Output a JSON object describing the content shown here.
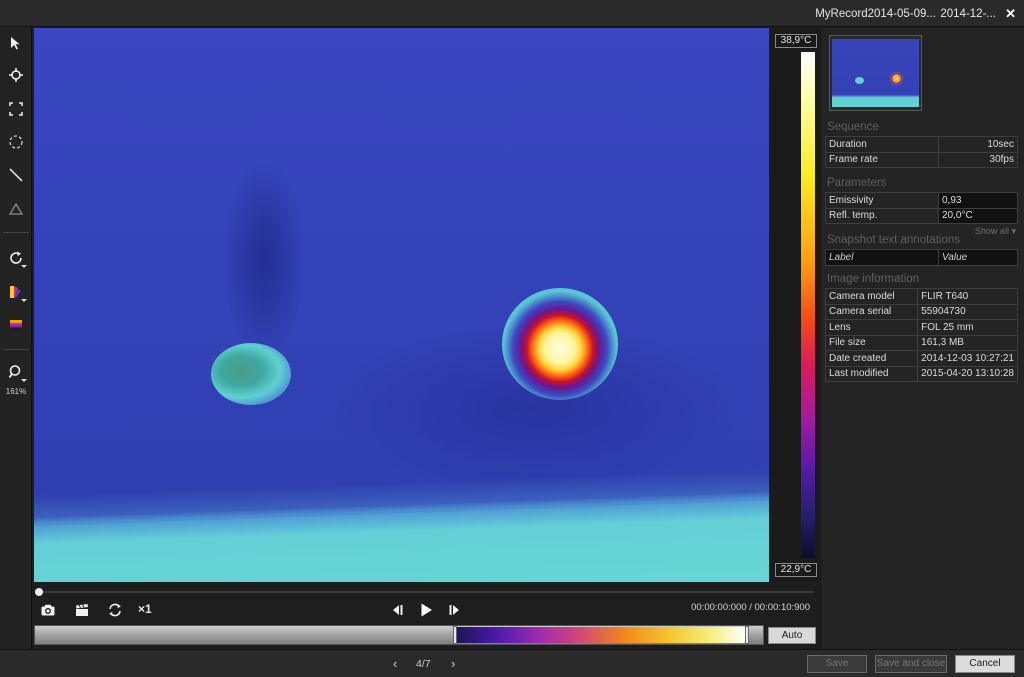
{
  "window": {
    "title": "MyRecord2014-05-09...",
    "title_secondary": "2014-12-...",
    "close_glyph": "✕"
  },
  "toolbar": {
    "zoom_label": "161%",
    "tools": [
      "select-arrow-icon",
      "spot-crosshair-icon",
      "box-area-icon",
      "ellipse-area-icon",
      "line-icon",
      "triangle-delta-icon",
      "rotate-icon",
      "palette-icon",
      "color-palette-icon",
      "zoom-icon"
    ]
  },
  "scale": {
    "max": "38,9°C",
    "min": "22,9°C",
    "colors": [
      "#ffffff",
      "#ffee20",
      "#ff9a10",
      "#dc1a5a",
      "#5a1aa8",
      "#0c0c28"
    ]
  },
  "playback": {
    "speed": "×1",
    "timecode": "00:00:00:000 / 00:00:10:900",
    "progress": 0.0
  },
  "palette_strip": {
    "auto_label": "Auto"
  },
  "panel": {
    "sequence": {
      "title": "Sequence",
      "rows": [
        {
          "k": "Duration",
          "v": "10sec"
        },
        {
          "k": "Frame rate",
          "v": "30fps"
        }
      ]
    },
    "parameters": {
      "title": "Parameters",
      "rows": [
        {
          "k": "Emissivity",
          "v": "0,93"
        },
        {
          "k": "Refl. temp.",
          "v": "20,0°C"
        }
      ],
      "show_all": "Show all"
    },
    "snapshot": {
      "title": "Snapshot text annotations",
      "header_label": "Label",
      "header_value": "Value"
    },
    "image_info": {
      "title": "Image information",
      "rows": [
        {
          "k": "Camera model",
          "v": "FLIR T640"
        },
        {
          "k": "Camera serial",
          "v": "55904730"
        },
        {
          "k": "Lens",
          "v": "FOL 25 mm"
        },
        {
          "k": "File size",
          "v": "161,3 MB"
        },
        {
          "k": "Date created",
          "v": "2014-12-03 10:27:21"
        },
        {
          "k": "Last modified",
          "v": "2015-04-20 13:10:28"
        }
      ]
    }
  },
  "footer": {
    "page": "4/7",
    "prev_glyph": "‹",
    "next_glyph": "›",
    "save": "Save",
    "save_close": "Save and close",
    "cancel": "Cancel"
  }
}
